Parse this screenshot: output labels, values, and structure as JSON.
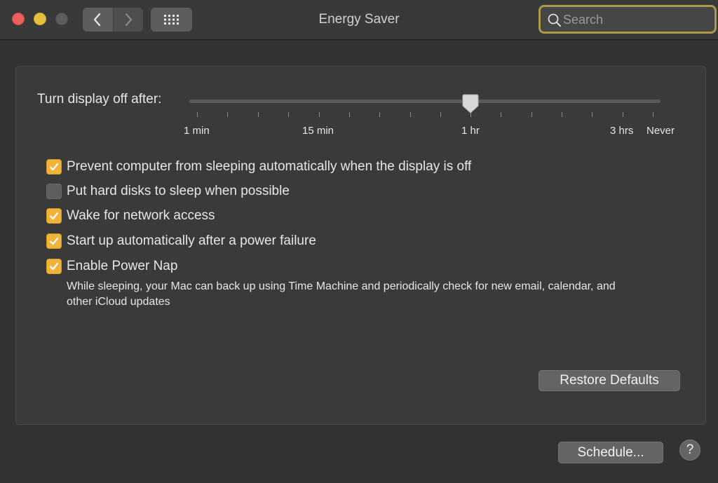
{
  "window": {
    "title": "Energy Saver",
    "search_placeholder": "Search"
  },
  "display_sleep": {
    "label": "Turn display off after:",
    "value_label": "1 hr",
    "tick_labels": [
      "1 min",
      "15 min",
      "1 hr",
      "3 hrs",
      "Never"
    ]
  },
  "options": [
    {
      "label": "Prevent computer from sleeping automatically when the display is off",
      "checked": true
    },
    {
      "label": "Put hard disks to sleep when possible",
      "checked": false
    },
    {
      "label": "Wake for network access",
      "checked": true
    },
    {
      "label": "Start up automatically after a power failure",
      "checked": true
    },
    {
      "label": "Enable Power Nap",
      "checked": true
    }
  ],
  "power_nap_description": "While sleeping, your Mac can back up using Time Machine and periodically check for new email, calendar, and other iCloud updates",
  "buttons": {
    "restore": "Restore Defaults",
    "schedule": "Schedule...",
    "help": "?"
  },
  "colors": {
    "checkbox_accent": "#f0b43a",
    "search_focus_ring": "#a89a4a"
  }
}
